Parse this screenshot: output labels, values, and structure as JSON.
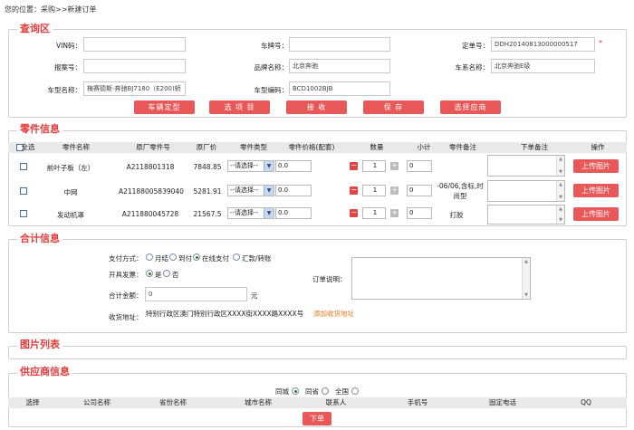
{
  "breadcrumb": "您的位置：采购>>新建订单",
  "query": {
    "legend": "查询区",
    "vin_label": "VIN码：",
    "vin_value": "",
    "plate_label": "车牌号：",
    "plate_value": "",
    "order_label": "定单号：",
    "order_value": "DDH20140813000000517",
    "reporter_label": "报案号：",
    "reporter_value": "",
    "brand_label": "品牌名称：",
    "brand_value": "北京奔驰",
    "series_label": "车系名称：",
    "series_value": "北京奔驰E级",
    "model_label": "车型名称：",
    "model_value": "梅赛德斯-奔驰BJ7180（E200)轿",
    "modelcode_label": "车型编码：",
    "modelcode_value": "BCD1002BJB",
    "buttons": [
      "车辆定型",
      "选 项 目",
      "接 收",
      "保 存",
      "选择应商"
    ]
  },
  "parts": {
    "legend": "零件信息",
    "select_all": "全选",
    "headers": [
      "零件名称",
      "原厂零件号",
      "原厂价",
      "零件类型",
      "零件价格(配套)",
      "数量",
      "小计",
      "零件备注",
      "下单备注",
      "操作"
    ],
    "rows": [
      {
        "name": "前叶子板（左）",
        "code": "A2118801318",
        "price": "7848.85",
        "type": "--请选择--",
        "part_price": "0.0",
        "qty": "1",
        "subtotal": "0",
        "remark": "",
        "upload": "上传图片"
      },
      {
        "name": "中网",
        "code": "A21188005839040",
        "price": "5281.91",
        "type": "--请选择--",
        "part_price": "0.0",
        "qty": "1",
        "subtotal": "0",
        "remark": "-06/06,含标,时尚型",
        "upload": "上传图片"
      },
      {
        "name": "发动机罩",
        "code": "A211880045728",
        "price": "21567.5",
        "type": "--请选择--",
        "part_price": "0.0",
        "qty": "1",
        "subtotal": "0",
        "remark": "打胶",
        "upload": "上传图片"
      }
    ]
  },
  "total": {
    "legend": "合计信息",
    "pay_label": "支付方式：",
    "pay_options": [
      "月结",
      "到付",
      "在线支付",
      "汇款/转账"
    ],
    "pay_selected": 2,
    "invoice_label": "开具发票：",
    "invoice_options": [
      "是",
      "否"
    ],
    "invoice_selected": 0,
    "amount_label": "合计金额：",
    "amount_value": "0",
    "amount_unit": "元",
    "address_label": "收货地址：",
    "address_value": "特别行政区澳门特别行政区XXXX街XXXX路XXXX号",
    "add_address": "添加收货地址",
    "remark_label": "订单说明："
  },
  "images": {
    "legend": "图片列表"
  },
  "supplier": {
    "legend": "供应商信息",
    "scope_options": [
      "同城",
      "同省",
      "全国"
    ],
    "scope_selected": 0,
    "headers": [
      "选择",
      "公司名称",
      "省份名称",
      "城市名称",
      "联系人",
      "手机号",
      "固定电话",
      "QQ"
    ],
    "order_button": "下单"
  },
  "colors": {
    "accent": "#e85858",
    "legend": "#e23b3b"
  }
}
